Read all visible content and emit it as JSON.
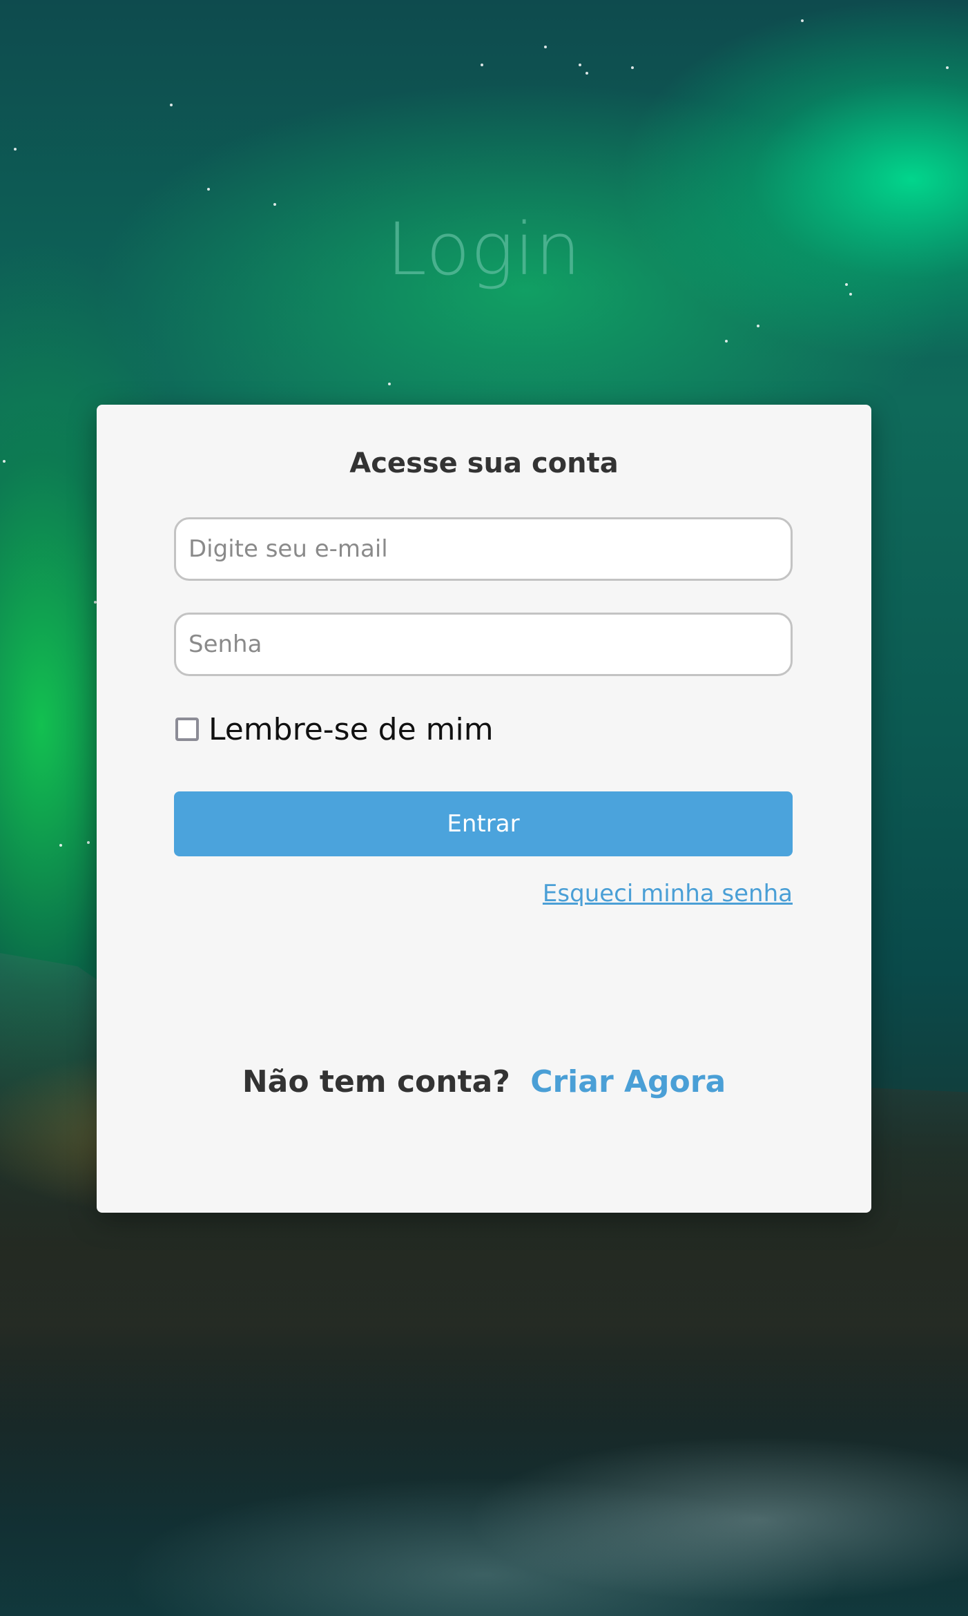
{
  "page": {
    "heading": "Login"
  },
  "card": {
    "title": "Acesse sua conta",
    "email_placeholder": "Digite seu e-mail",
    "password_placeholder": "Senha",
    "remember_label": "Lembre-se de mim",
    "remember_checked": false,
    "submit_label": "Entrar",
    "forgot_label": "Esqueci minha senha",
    "signup_question": "Não tem conta?",
    "signup_link": "Criar Agora"
  },
  "colors": {
    "accent": "#4ba3dc",
    "link": "#4a9fd6",
    "card_background": "#f6f6f6",
    "heading": "#5fbea0"
  }
}
